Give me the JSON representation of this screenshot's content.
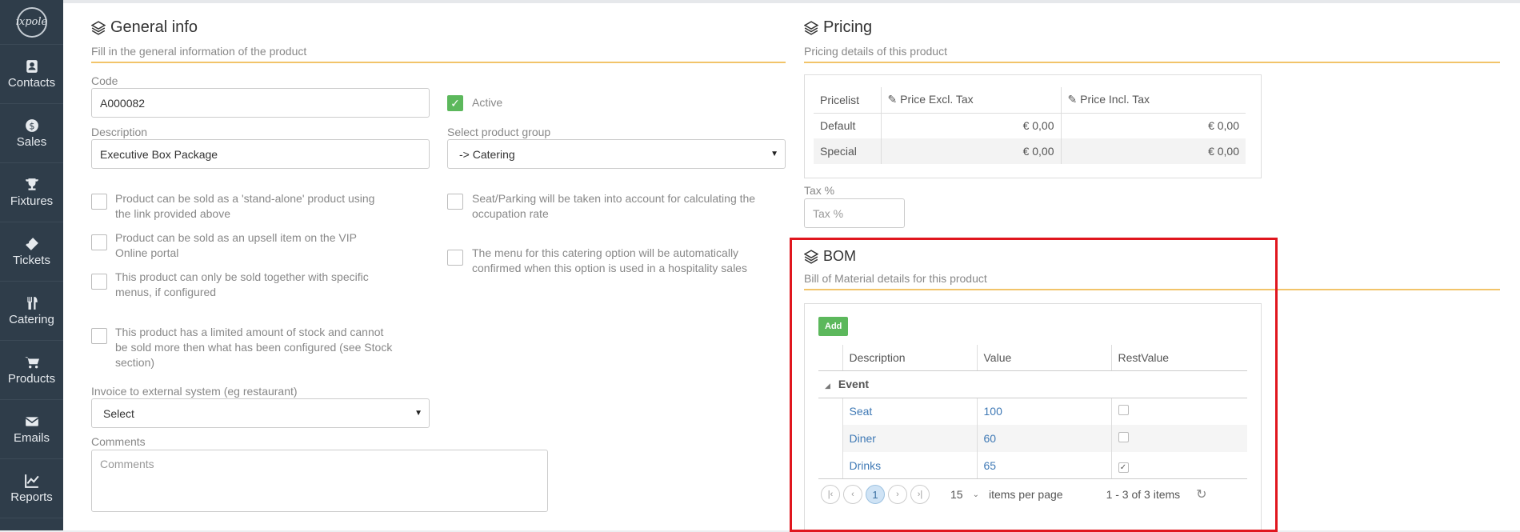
{
  "brand": {
    "logo_text": "ixpole"
  },
  "sidebar": {
    "items": [
      {
        "label": "Contacts",
        "icon": "contacts-icon"
      },
      {
        "label": "Sales",
        "icon": "sales-icon"
      },
      {
        "label": "Fixtures",
        "icon": "trophy-icon"
      },
      {
        "label": "Tickets",
        "icon": "ticket-icon"
      },
      {
        "label": "Catering",
        "icon": "cutlery-icon"
      },
      {
        "label": "Products",
        "icon": "cart-icon"
      },
      {
        "label": "Emails",
        "icon": "envelope-icon"
      },
      {
        "label": "Reports",
        "icon": "chart-icon"
      }
    ]
  },
  "general": {
    "title": "General info",
    "subtitle": "Fill in the general information of the product",
    "code_label": "Code",
    "code_value": "A000082",
    "active_label": "Active",
    "description_label": "Description",
    "description_value": "Executive Box Package",
    "product_group_label": "Select product group",
    "product_group_value": "-> Catering",
    "options_left": [
      "Product can be sold as a 'stand-alone' product using the link provided above",
      "Product can be sold as an upsell item on the VIP Online portal",
      "This product can only be sold together with specific menus, if configured",
      "This product has a limited amount of stock and cannot be sold more then what has been configured (see Stock section)"
    ],
    "options_right": [
      "Seat/Parking will be taken into account for calculating the occupation rate",
      "The menu for this catering option will be automatically confirmed when this option is used in a hospitality sales"
    ],
    "invoice_label": "Invoice to external system (eg restaurant)",
    "invoice_value": "Select",
    "comments_label": "Comments",
    "comments_placeholder": "Comments"
  },
  "pricing": {
    "title": "Pricing",
    "subtitle": "Pricing details of this product",
    "headers": [
      "Pricelist",
      "Price Excl. Tax",
      "Price Incl. Tax"
    ],
    "rows": [
      {
        "name": "Default",
        "excl": "€ 0,00",
        "incl": "€ 0,00"
      },
      {
        "name": "Special",
        "excl": "€ 0,00",
        "incl": "€ 0,00"
      }
    ],
    "tax_label": "Tax %",
    "tax_placeholder": "Tax %"
  },
  "bom": {
    "title": "BOM",
    "subtitle": "Bill of Material details for this product",
    "add_label": "Add",
    "headers": [
      "Description",
      "Value",
      "RestValue"
    ],
    "group": "Event",
    "rows": [
      {
        "description": "Seat",
        "value": "100",
        "rest": false
      },
      {
        "description": "Diner",
        "value": "60",
        "rest": false
      },
      {
        "description": "Drinks",
        "value": "65",
        "rest": true
      }
    ],
    "pager": {
      "current_page": "1",
      "page_size": "15",
      "per_page_label": "items per page",
      "summary": "1 - 3 of 3 items"
    }
  },
  "colors": {
    "accent": "#f2c46a",
    "sidebar": "#2f3d4a",
    "add_button": "#5cb85c",
    "highlight": "#e0161e",
    "link": "#3f79b5"
  }
}
